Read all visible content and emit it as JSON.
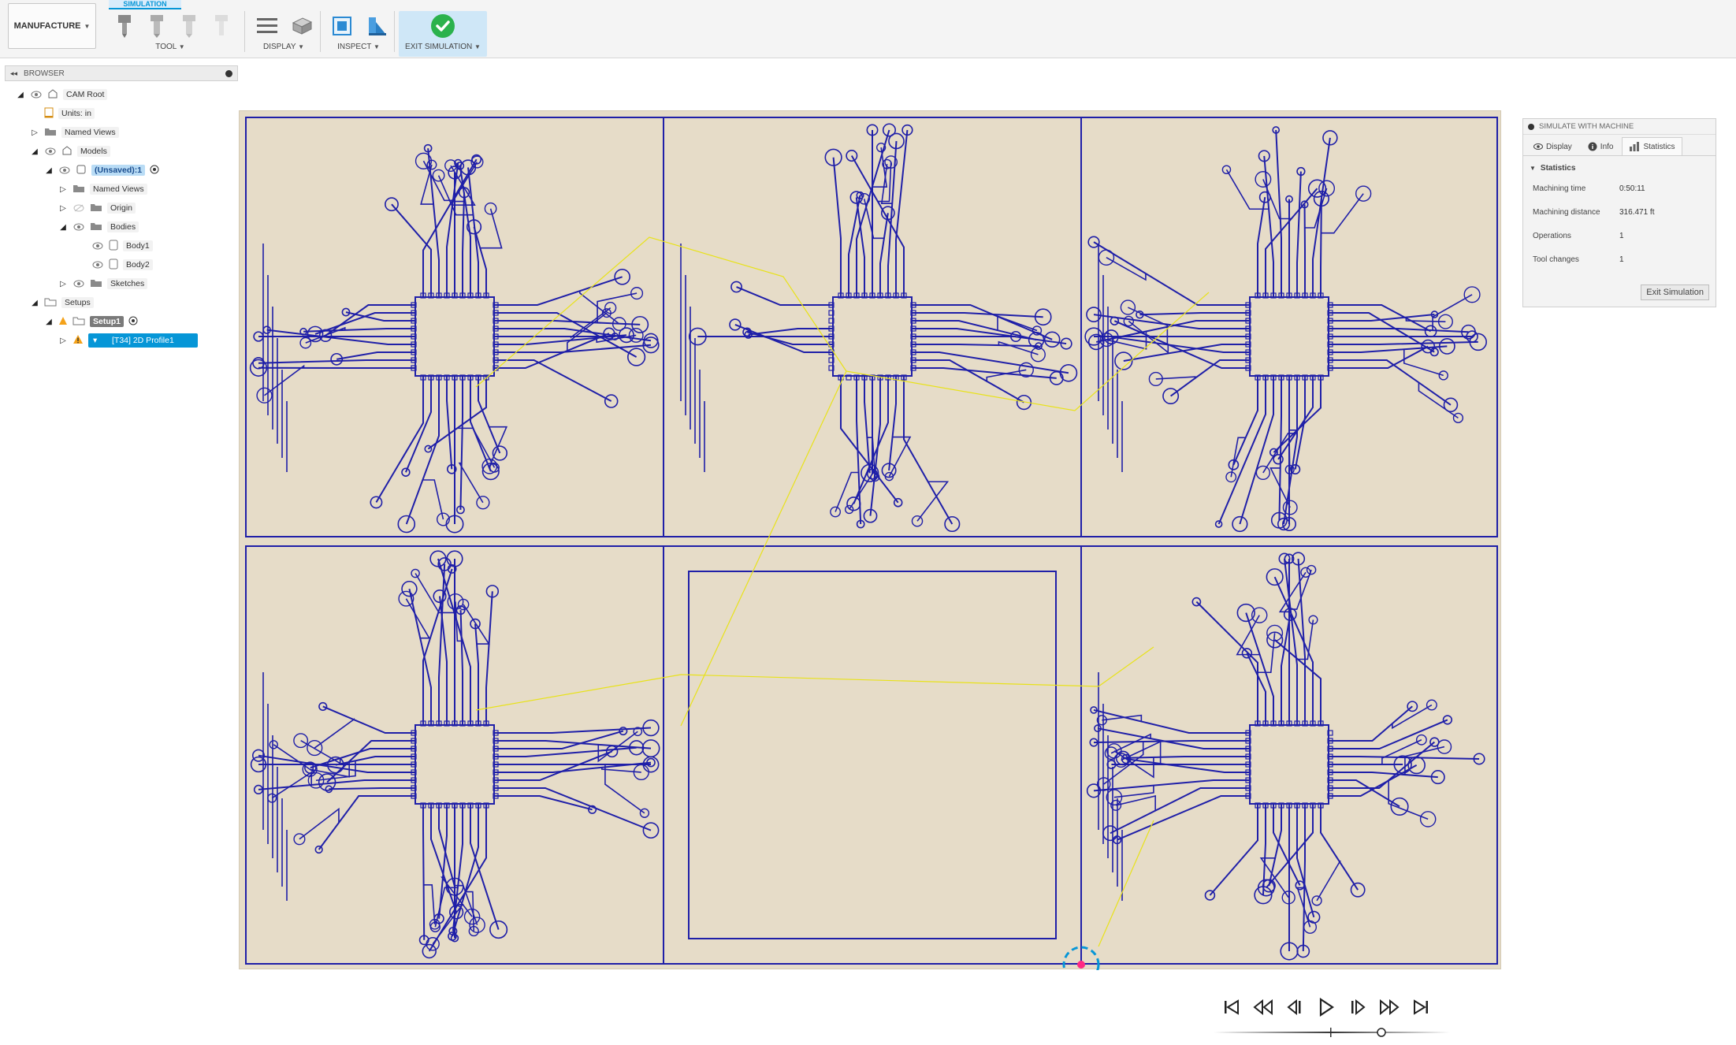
{
  "toolbar": {
    "workspace_label": "MANUFACTURE",
    "active_tab": "SIMULATION",
    "groups": {
      "tool": "TOOL",
      "display": "DISPLAY",
      "inspect": "INSPECT",
      "exit_simulation": "EXIT SIMULATION"
    }
  },
  "browser": {
    "title": "BROWSER",
    "tree": {
      "cam_root": "CAM Root",
      "units": "Units: in",
      "named_views": "Named Views",
      "models": "Models",
      "unsaved": "(Unsaved):1",
      "model_named_views": "Named Views",
      "origin": "Origin",
      "bodies": "Bodies",
      "body1": "Body1",
      "body2": "Body2",
      "sketches": "Sketches",
      "setups": "Setups",
      "setup1": "Setup1",
      "operation": "[T34] 2D Profile1"
    }
  },
  "sim_panel": {
    "title": "SIMULATE WITH MACHINE",
    "tabs": {
      "display": "Display",
      "info": "Info",
      "statistics": "Statistics"
    },
    "section": "Statistics",
    "stats": [
      {
        "key": "Machining time",
        "value": "0:50:11"
      },
      {
        "key": "Machining distance",
        "value": "316.471 ft"
      },
      {
        "key": "Operations",
        "value": "1"
      },
      {
        "key": "Tool changes",
        "value": "1"
      }
    ],
    "exit_button": "Exit Simulation"
  },
  "colors": {
    "accent": "#0696d7",
    "stock": "#e6dcc8",
    "toolpath": "#1f1fa8",
    "rapid": "#e8e21a",
    "tool_marker": "#ff2a84"
  }
}
